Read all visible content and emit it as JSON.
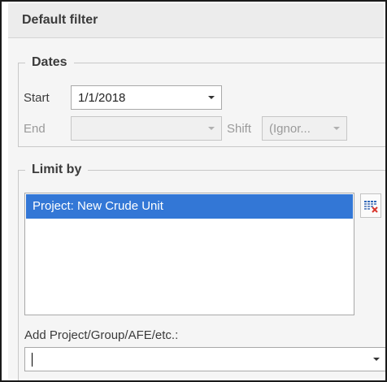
{
  "header": {
    "title": "Default filter"
  },
  "dates": {
    "legend": "Dates",
    "start_label": "Start",
    "start_value": "1/1/2018",
    "end_label": "End",
    "end_value": "",
    "shift_label": "Shift",
    "shift_value": "(Ignor..."
  },
  "limit_by": {
    "legend": "Limit by",
    "items": [
      {
        "label": "Project: New Crude Unit",
        "selected": true
      }
    ],
    "add_label": "Add Project/Group/AFE/etc.:",
    "add_value": "",
    "clear_button_icon": "grid-clear-icon"
  },
  "colors": {
    "selection": "#3377d6",
    "panel_background": "#f5f5f5",
    "header_background": "#ececec",
    "icon_red": "#d9342b",
    "icon_blue": "#2e66b8"
  }
}
